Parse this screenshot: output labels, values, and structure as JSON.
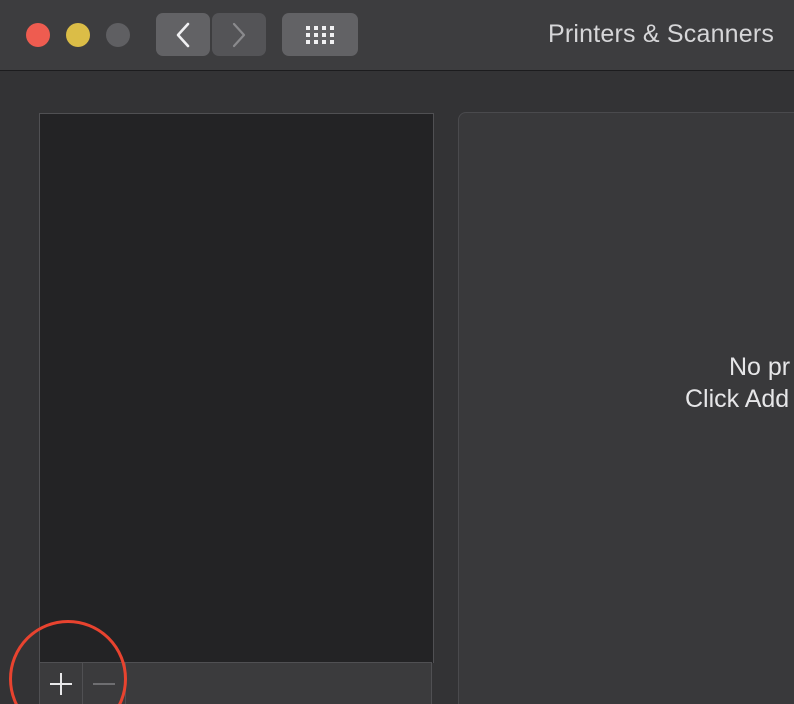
{
  "window": {
    "title": "Printers & Scanners"
  },
  "traffic_lights": {
    "close_color": "#ee5c50",
    "minimize_color": "#dbbd47",
    "zoom_color": "#5f5f62"
  },
  "toolbar": {
    "back_icon": "chevron-left-icon",
    "forward_icon": "chevron-right-icon",
    "grid_icon": "show-all-grid-icon"
  },
  "printer_list": {
    "items": [],
    "add_icon": "plus-icon",
    "remove_icon": "minus-icon"
  },
  "detail": {
    "empty_line_1": "No pr",
    "empty_line_2": "Click Add"
  },
  "annotation": {
    "highlight_color": "#e8432f"
  }
}
